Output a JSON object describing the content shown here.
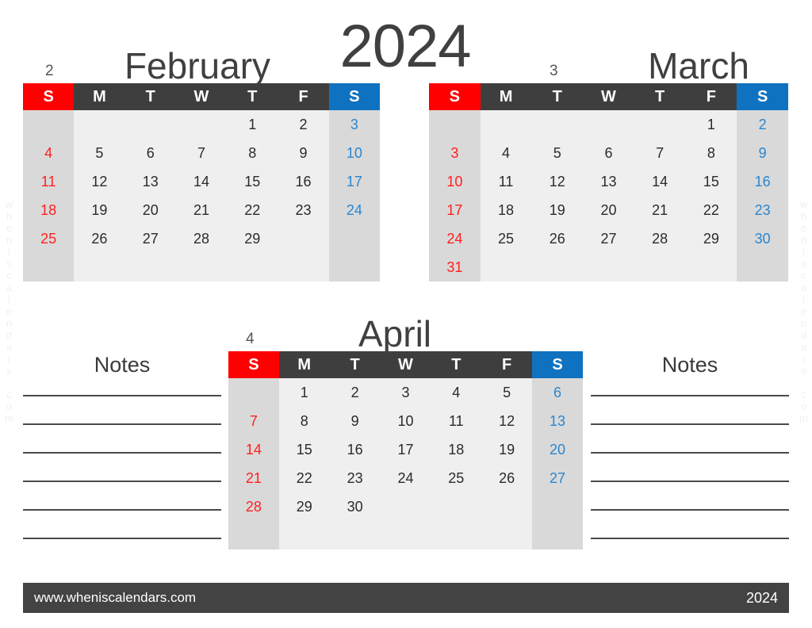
{
  "document": {
    "year_title": "2024",
    "watermark_text": "wheniscalendars.com"
  },
  "footer": {
    "site": "www.wheniscalendars.com",
    "year": "2024"
  },
  "colors": {
    "sunday_header": "#FF0000",
    "saturday_header": "#0F72C0",
    "weekday_header": "#3E3E3E",
    "weekend_cell": "#D9D9D9",
    "weekday_cell": "#EFEFEF",
    "sunday_text": "#FF2020",
    "saturday_text": "#2A86D0",
    "footer_bar": "#434343",
    "title_text": "#404040"
  },
  "weekday_headers": [
    "S",
    "M",
    "T",
    "W",
    "T",
    "F",
    "S"
  ],
  "months": [
    {
      "number": "2",
      "name": "February",
      "weeks": [
        [
          "",
          "",
          "",
          "",
          "1",
          "2",
          "3"
        ],
        [
          "4",
          "5",
          "6",
          "7",
          "8",
          "9",
          "10"
        ],
        [
          "11",
          "12",
          "13",
          "14",
          "15",
          "16",
          "17"
        ],
        [
          "18",
          "19",
          "20",
          "21",
          "22",
          "23",
          "24"
        ],
        [
          "25",
          "26",
          "27",
          "28",
          "29",
          "",
          ""
        ],
        [
          "",
          "",
          "",
          "",
          "",
          "",
          ""
        ]
      ]
    },
    {
      "number": "3",
      "name": "March",
      "weeks": [
        [
          "",
          "",
          "",
          "",
          "",
          "1",
          "2"
        ],
        [
          "3",
          "4",
          "5",
          "6",
          "7",
          "8",
          "9"
        ],
        [
          "10",
          "11",
          "12",
          "13",
          "14",
          "15",
          "16"
        ],
        [
          "17",
          "18",
          "19",
          "20",
          "21",
          "22",
          "23"
        ],
        [
          "24",
          "25",
          "26",
          "27",
          "28",
          "29",
          "30"
        ],
        [
          "31",
          "",
          "",
          "",
          "",
          "",
          ""
        ]
      ]
    },
    {
      "number": "4",
      "name": "April",
      "weeks": [
        [
          "",
          "1",
          "2",
          "3",
          "4",
          "5",
          "6"
        ],
        [
          "7",
          "8",
          "9",
          "10",
          "11",
          "12",
          "13"
        ],
        [
          "14",
          "15",
          "16",
          "17",
          "18",
          "19",
          "20"
        ],
        [
          "21",
          "22",
          "23",
          "24",
          "25",
          "26",
          "27"
        ],
        [
          "28",
          "29",
          "30",
          "",
          "",
          "",
          ""
        ],
        [
          "",
          "",
          "",
          "",
          "",
          "",
          ""
        ]
      ]
    }
  ],
  "notes_panels": [
    {
      "title": "Notes",
      "line_count": 6
    },
    {
      "title": "Notes",
      "line_count": 6
    }
  ]
}
